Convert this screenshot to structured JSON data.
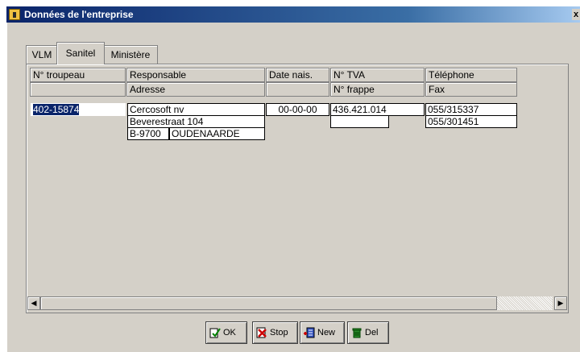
{
  "window": {
    "title": "Données de l'entreprise",
    "close_label": "x"
  },
  "tabs": [
    {
      "label": "VLM"
    },
    {
      "label": "Sanitel"
    },
    {
      "label": "Ministère"
    }
  ],
  "active_tab": "Sanitel",
  "headers": {
    "troupeau": "N° troupeau",
    "responsable": "Responsable",
    "adresse": "Adresse",
    "date_nais": "Date nais.",
    "tva": "N° TVA",
    "frappe": "N° frappe",
    "telephone": "Téléphone",
    "fax": "Fax"
  },
  "record": {
    "troupeau": "402-15874",
    "responsable": "Cercosoft nv",
    "adresse": "Beverestraat 104",
    "code_postal": "B-9700",
    "commune": "OUDENAARDE",
    "date_nais": "00-00-00",
    "tva": "436.421.014",
    "frappe": "",
    "telephone": "055/315337",
    "fax": "055/301451"
  },
  "buttons": {
    "ok": "OK",
    "stop": "Stop",
    "new": "New",
    "del": "Del"
  },
  "icons": {
    "ok": "check-doc-icon",
    "stop": "red-x-icon",
    "new": "new-record-icon",
    "del": "trash-icon"
  }
}
